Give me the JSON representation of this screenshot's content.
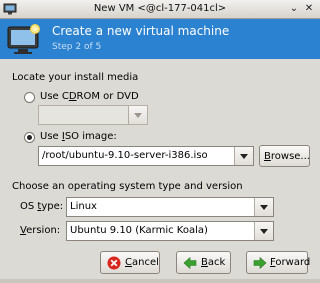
{
  "window": {
    "title": "New VM <@cl-177-041cl>",
    "minimize": "⌄",
    "close": "✕"
  },
  "banner": {
    "title": "Create a new virtual machine",
    "step": "Step 2 of 5"
  },
  "install_media": {
    "heading": "Locate your install media",
    "cdrom_pre": "Use C",
    "cdrom_u": "D",
    "cdrom_post": "ROM or DVD",
    "cdrom_selected": false,
    "iso_pre": "Use ",
    "iso_u": "I",
    "iso_post": "SO image:",
    "iso_selected": true,
    "iso_path": "/root/ubuntu-9.10-server-i386.iso",
    "browse_u": "B",
    "browse_post": "rowse..."
  },
  "os": {
    "heading": "Choose an operating system type and version",
    "type_label_pre": "OS ",
    "type_label_u": "t",
    "type_label_post": "ype:",
    "type_value": "Linux",
    "version_label_pre": "",
    "version_label_u": "V",
    "version_label_post": "ersion:",
    "version_value": "Ubuntu 9.10 (Karmic Koala)"
  },
  "buttons": {
    "cancel_u": "C",
    "cancel_post": "ancel",
    "back_u": "B",
    "back_post": "ack",
    "forward_u": "F",
    "forward_post": "orward"
  },
  "colors": {
    "banner": "#2b82d0",
    "cancel_icon": "#d9261c",
    "nav_icon": "#3aa02e"
  }
}
